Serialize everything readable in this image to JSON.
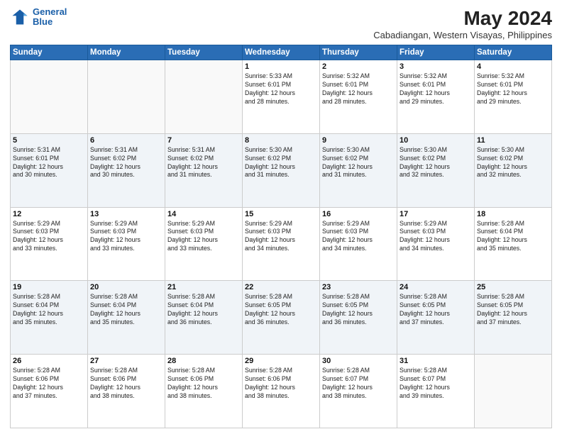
{
  "header": {
    "logo_line1": "General",
    "logo_line2": "Blue",
    "main_title": "May 2024",
    "subtitle": "Cabadiangan, Western Visayas, Philippines"
  },
  "days_of_week": [
    "Sunday",
    "Monday",
    "Tuesday",
    "Wednesday",
    "Thursday",
    "Friday",
    "Saturday"
  ],
  "weeks": [
    [
      {
        "day": "",
        "info": ""
      },
      {
        "day": "",
        "info": ""
      },
      {
        "day": "",
        "info": ""
      },
      {
        "day": "1",
        "info": "Sunrise: 5:33 AM\nSunset: 6:01 PM\nDaylight: 12 hours\nand 28 minutes."
      },
      {
        "day": "2",
        "info": "Sunrise: 5:32 AM\nSunset: 6:01 PM\nDaylight: 12 hours\nand 28 minutes."
      },
      {
        "day": "3",
        "info": "Sunrise: 5:32 AM\nSunset: 6:01 PM\nDaylight: 12 hours\nand 29 minutes."
      },
      {
        "day": "4",
        "info": "Sunrise: 5:32 AM\nSunset: 6:01 PM\nDaylight: 12 hours\nand 29 minutes."
      }
    ],
    [
      {
        "day": "5",
        "info": "Sunrise: 5:31 AM\nSunset: 6:01 PM\nDaylight: 12 hours\nand 30 minutes."
      },
      {
        "day": "6",
        "info": "Sunrise: 5:31 AM\nSunset: 6:02 PM\nDaylight: 12 hours\nand 30 minutes."
      },
      {
        "day": "7",
        "info": "Sunrise: 5:31 AM\nSunset: 6:02 PM\nDaylight: 12 hours\nand 31 minutes."
      },
      {
        "day": "8",
        "info": "Sunrise: 5:30 AM\nSunset: 6:02 PM\nDaylight: 12 hours\nand 31 minutes."
      },
      {
        "day": "9",
        "info": "Sunrise: 5:30 AM\nSunset: 6:02 PM\nDaylight: 12 hours\nand 31 minutes."
      },
      {
        "day": "10",
        "info": "Sunrise: 5:30 AM\nSunset: 6:02 PM\nDaylight: 12 hours\nand 32 minutes."
      },
      {
        "day": "11",
        "info": "Sunrise: 5:30 AM\nSunset: 6:02 PM\nDaylight: 12 hours\nand 32 minutes."
      }
    ],
    [
      {
        "day": "12",
        "info": "Sunrise: 5:29 AM\nSunset: 6:03 PM\nDaylight: 12 hours\nand 33 minutes."
      },
      {
        "day": "13",
        "info": "Sunrise: 5:29 AM\nSunset: 6:03 PM\nDaylight: 12 hours\nand 33 minutes."
      },
      {
        "day": "14",
        "info": "Sunrise: 5:29 AM\nSunset: 6:03 PM\nDaylight: 12 hours\nand 33 minutes."
      },
      {
        "day": "15",
        "info": "Sunrise: 5:29 AM\nSunset: 6:03 PM\nDaylight: 12 hours\nand 34 minutes."
      },
      {
        "day": "16",
        "info": "Sunrise: 5:29 AM\nSunset: 6:03 PM\nDaylight: 12 hours\nand 34 minutes."
      },
      {
        "day": "17",
        "info": "Sunrise: 5:29 AM\nSunset: 6:03 PM\nDaylight: 12 hours\nand 34 minutes."
      },
      {
        "day": "18",
        "info": "Sunrise: 5:28 AM\nSunset: 6:04 PM\nDaylight: 12 hours\nand 35 minutes."
      }
    ],
    [
      {
        "day": "19",
        "info": "Sunrise: 5:28 AM\nSunset: 6:04 PM\nDaylight: 12 hours\nand 35 minutes."
      },
      {
        "day": "20",
        "info": "Sunrise: 5:28 AM\nSunset: 6:04 PM\nDaylight: 12 hours\nand 35 minutes."
      },
      {
        "day": "21",
        "info": "Sunrise: 5:28 AM\nSunset: 6:04 PM\nDaylight: 12 hours\nand 36 minutes."
      },
      {
        "day": "22",
        "info": "Sunrise: 5:28 AM\nSunset: 6:05 PM\nDaylight: 12 hours\nand 36 minutes."
      },
      {
        "day": "23",
        "info": "Sunrise: 5:28 AM\nSunset: 6:05 PM\nDaylight: 12 hours\nand 36 minutes."
      },
      {
        "day": "24",
        "info": "Sunrise: 5:28 AM\nSunset: 6:05 PM\nDaylight: 12 hours\nand 37 minutes."
      },
      {
        "day": "25",
        "info": "Sunrise: 5:28 AM\nSunset: 6:05 PM\nDaylight: 12 hours\nand 37 minutes."
      }
    ],
    [
      {
        "day": "26",
        "info": "Sunrise: 5:28 AM\nSunset: 6:06 PM\nDaylight: 12 hours\nand 37 minutes."
      },
      {
        "day": "27",
        "info": "Sunrise: 5:28 AM\nSunset: 6:06 PM\nDaylight: 12 hours\nand 38 minutes."
      },
      {
        "day": "28",
        "info": "Sunrise: 5:28 AM\nSunset: 6:06 PM\nDaylight: 12 hours\nand 38 minutes."
      },
      {
        "day": "29",
        "info": "Sunrise: 5:28 AM\nSunset: 6:06 PM\nDaylight: 12 hours\nand 38 minutes."
      },
      {
        "day": "30",
        "info": "Sunrise: 5:28 AM\nSunset: 6:07 PM\nDaylight: 12 hours\nand 38 minutes."
      },
      {
        "day": "31",
        "info": "Sunrise: 5:28 AM\nSunset: 6:07 PM\nDaylight: 12 hours\nand 39 minutes."
      },
      {
        "day": "",
        "info": ""
      }
    ]
  ]
}
